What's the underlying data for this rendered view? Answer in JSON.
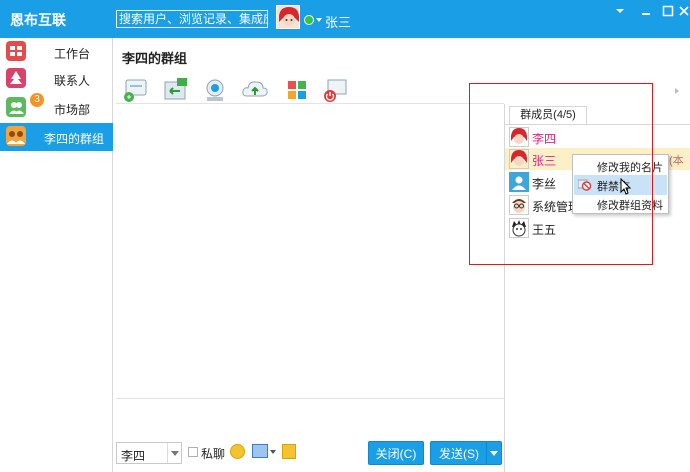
{
  "app": {
    "title": "恩布互联"
  },
  "header": {
    "search_placeholder": "搜索用户、浏览记录、集成应用(/)",
    "username": "张三",
    "status_color": "#35c343"
  },
  "window_controls": [
    "minimize-icon",
    "restore-icon",
    "close-icon"
  ],
  "sidebar": {
    "items": [
      {
        "label": "工作台",
        "icon": "grid-icon",
        "color": "#e54b4b"
      },
      {
        "label": "联系人",
        "icon": "tree-icon",
        "color": "#d9426a"
      },
      {
        "label": "市场部",
        "icon": "group-icon",
        "color": "#5bb95e",
        "badge": "3"
      },
      {
        "label": "李四的群组",
        "icon": "group-users-icon",
        "color": "#f2a33a",
        "active": true
      }
    ]
  },
  "chat": {
    "title": "李四的群组",
    "toolbar": [
      "group-chat-icon",
      "share-file-icon",
      "webcam-icon",
      "cloud-upload-icon",
      "apps-icon",
      "remote-desktop-icon"
    ]
  },
  "bottom": {
    "sender": "李四",
    "private_label": "私聊",
    "close_label": "关闭(C)",
    "send_label": "发送(S)"
  },
  "members": {
    "tab_label": "群成员(4/5)",
    "list": [
      {
        "name": "李四",
        "color": "#e91e8c",
        "avatar": "red-hair-avatar"
      },
      {
        "name": "张三",
        "color": "#e91e8c",
        "avatar": "red-hair-avatar",
        "highlight": true,
        "extra": "(本"
      },
      {
        "name": "李丝",
        "color": "#222222",
        "avatar": "default-user-avatar"
      },
      {
        "name": "系统管理",
        "color": "#222222",
        "avatar": "glasses-avatar"
      },
      {
        "name": "王五",
        "color": "#222222",
        "avatar": "cartoon-avatar"
      }
    ]
  },
  "context_menu": {
    "items": [
      {
        "label": "修改我的名片"
      },
      {
        "label": "群禁言",
        "icon": "ban-icon",
        "selected": true
      },
      {
        "label": "修改群组资料"
      }
    ]
  }
}
